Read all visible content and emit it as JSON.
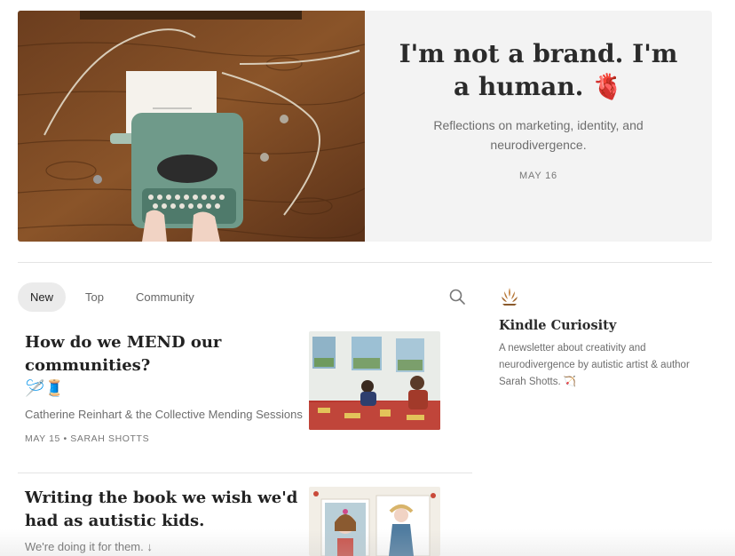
{
  "hero": {
    "title": "I'm not a brand. I'm a human.",
    "title_emoji": "🫀",
    "subtitle": "Reflections on marketing, identity, and neurodivergence.",
    "date": "MAY 16"
  },
  "tabs": [
    {
      "label": "New",
      "active": true
    },
    {
      "label": "Top",
      "active": false
    },
    {
      "label": "Community",
      "active": false
    }
  ],
  "posts": [
    {
      "title": "How do we MEND our communities?",
      "emoji": "🪡🧵",
      "subtitle": "Catherine Reinhart & the Collective Mending Sessions",
      "meta": "MAY 15 • SARAH SHOTTS"
    },
    {
      "title": "Writing the book we wish we'd had as autistic kids.",
      "subtitle": "We're doing it for them. ↓"
    }
  ],
  "sidebar": {
    "name": "Kindle Curiosity",
    "description": "A newsletter about creativity and neurodivergence by autistic artist & author Sarah Shotts. 🏹"
  },
  "colors": {
    "hero_panel": "#f3f3f3",
    "tab_active_bg": "#ebebeb",
    "divider": "#e4e4e4"
  }
}
